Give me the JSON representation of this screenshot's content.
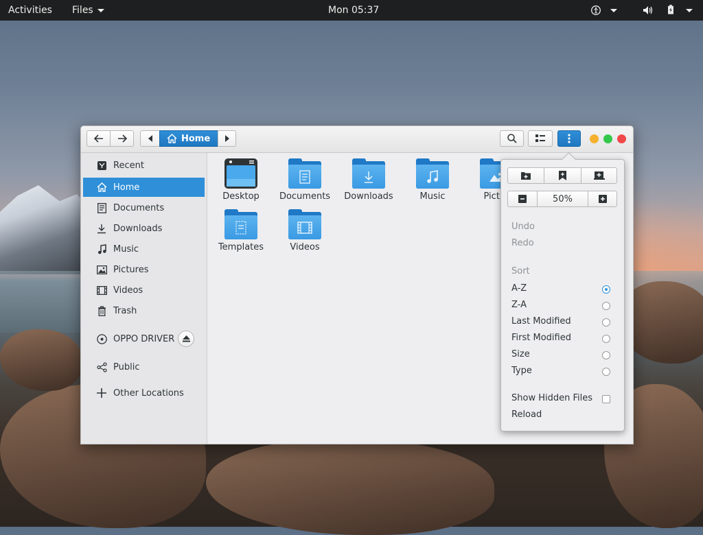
{
  "topbar": {
    "activities": "Activities",
    "app_menu": "Files",
    "clock": "Mon 05:37",
    "tray_icons": [
      "accessibility-icon",
      "volume-icon",
      "battery-icon"
    ]
  },
  "window": {
    "breadcrumb": {
      "current": "Home"
    },
    "colors": {
      "accent": "#2f8fd8",
      "minimize": "#f4b12e",
      "maximize": "#34c84a",
      "close": "#f04848"
    }
  },
  "sidebar": {
    "items": [
      {
        "label": "Recent",
        "icon": "clock-icon"
      },
      {
        "label": "Home",
        "icon": "home-icon",
        "selected": true
      },
      {
        "label": "Documents",
        "icon": "document-icon"
      },
      {
        "label": "Downloads",
        "icon": "download-icon"
      },
      {
        "label": "Music",
        "icon": "music-icon"
      },
      {
        "label": "Pictures",
        "icon": "picture-icon"
      },
      {
        "label": "Videos",
        "icon": "film-icon"
      },
      {
        "label": "Trash",
        "icon": "trash-icon"
      }
    ],
    "devices": [
      {
        "label": "OPPO DRIVER",
        "icon": "disc-icon"
      }
    ],
    "network": [
      {
        "label": "Public",
        "icon": "share-icon"
      },
      {
        "label": "Other Locations",
        "icon": "plus-icon"
      }
    ]
  },
  "files": [
    {
      "label": "Desktop",
      "icon": "desktop-icon"
    },
    {
      "label": "Documents",
      "icon": "folder-documents-icon"
    },
    {
      "label": "Downloads",
      "icon": "folder-downloads-icon"
    },
    {
      "label": "Music",
      "icon": "folder-music-icon"
    },
    {
      "label": "Pictur",
      "icon": "folder-pictures-icon"
    },
    {
      "label": "Templates",
      "icon": "folder-templates-icon"
    },
    {
      "label": "Videos",
      "icon": "folder-videos-icon"
    }
  ],
  "menu": {
    "zoom": "50%",
    "undo": "Undo",
    "redo": "Redo",
    "sort_heading": "Sort",
    "sort_options": [
      "A-Z",
      "Z-A",
      "Last Modified",
      "First Modified",
      "Size",
      "Type"
    ],
    "sort_selected": "A-Z",
    "show_hidden": "Show Hidden Files",
    "show_hidden_checked": false,
    "reload": "Reload"
  }
}
